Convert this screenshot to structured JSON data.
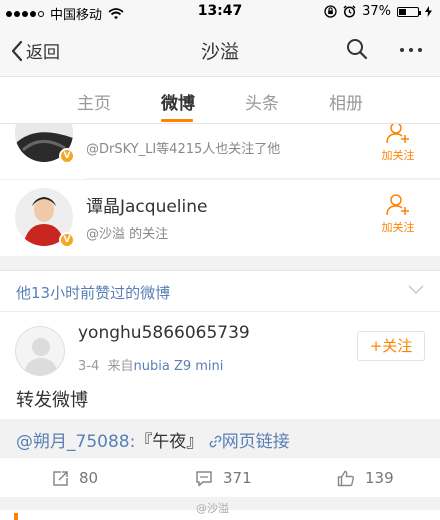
{
  "status_bar": {
    "carrier": "中国移动",
    "time": "13:47",
    "battery": "37%",
    "battery_level": 0.37
  },
  "nav": {
    "back_label": "返回",
    "title": "沙溢"
  },
  "tabs": [
    {
      "label": "主页",
      "active": false
    },
    {
      "label": "微博",
      "active": true
    },
    {
      "label": "头条",
      "active": false
    },
    {
      "label": "相册",
      "active": false
    }
  ],
  "users": [
    {
      "name": "",
      "subtitle": "@DrSKY_LI等4215人也关注了他",
      "follow_label": "加关注"
    },
    {
      "name": "谭晶Jacqueline",
      "subtitle": "@沙溢 的关注",
      "follow_label": "加关注"
    }
  ],
  "liked_section": {
    "title": "他13小时前赞过的微博"
  },
  "post": {
    "author": "yonghu5866065739",
    "date": "3-4",
    "source_prefix": "来自",
    "device": "nubia Z9 mini",
    "follow_button": "+关注",
    "text": "转发微博",
    "repost": {
      "mention": "@朔月_75088:",
      "content": "『午夜』",
      "link_label": "网页链接"
    },
    "actions": {
      "reposts": "80",
      "comments": "371",
      "likes": "139"
    }
  },
  "watermark": "@沙溢"
}
